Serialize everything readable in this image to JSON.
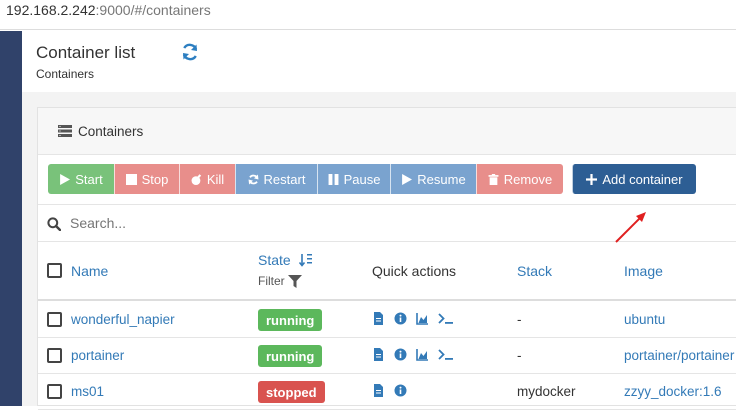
{
  "browser": {
    "url_host": "192.168.2.242",
    "url_path": ":9000/#/containers"
  },
  "header": {
    "title": "Container list",
    "subtitle": "Containers"
  },
  "widget": {
    "title": "Containers"
  },
  "toolbar": {
    "start": "Start",
    "stop": "Stop",
    "kill": "Kill",
    "restart": "Restart",
    "pause": "Pause",
    "resume": "Resume",
    "remove": "Remove",
    "add": "Add container"
  },
  "search": {
    "placeholder": "Search..."
  },
  "table": {
    "columns": {
      "name": "Name",
      "state": "State",
      "filter": "Filter",
      "quick_actions": "Quick actions",
      "stack": "Stack",
      "image": "Image"
    },
    "rows": [
      {
        "name": "wonderful_napier",
        "state": "running",
        "stack": "-",
        "image": "ubuntu"
      },
      {
        "name": "portainer",
        "state": "running",
        "stack": "-",
        "image": "portainer/portainer"
      },
      {
        "name": "ms01",
        "state": "stopped",
        "stack": "mydocker",
        "image": "zzyy_docker:1.6"
      }
    ]
  },
  "colors": {
    "sidebar": "#30426a",
    "link": "#337ab7",
    "running": "#5cb85c",
    "stopped": "#d9534f",
    "add_button": "#2d5e94",
    "annotation_arrow": "#e02020"
  }
}
